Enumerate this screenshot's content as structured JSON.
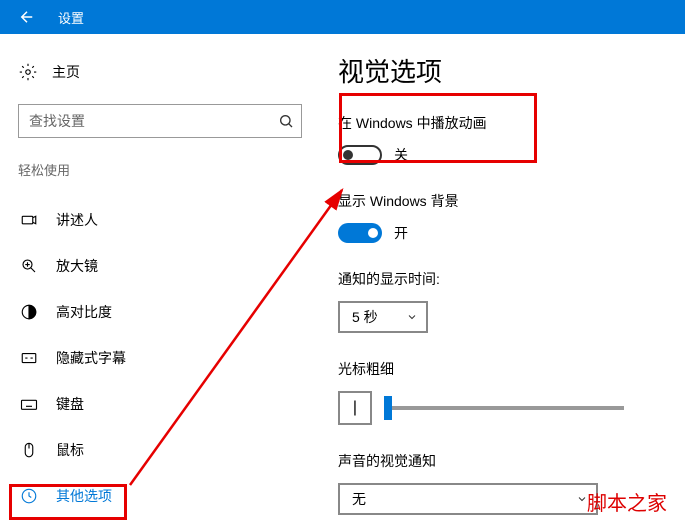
{
  "titlebar": {
    "title": "设置"
  },
  "sidebar": {
    "home": "主页",
    "search_placeholder": "查找设置",
    "category": "轻松使用",
    "items": [
      {
        "label": "讲述人"
      },
      {
        "label": "放大镜"
      },
      {
        "label": "高对比度"
      },
      {
        "label": "隐藏式字幕"
      },
      {
        "label": "键盘"
      },
      {
        "label": "鼠标"
      },
      {
        "label": "其他选项"
      }
    ]
  },
  "main": {
    "title": "视觉选项",
    "animations": {
      "label": "在 Windows 中播放动画",
      "state": "关"
    },
    "background": {
      "label": "显示 Windows 背景",
      "state": "开"
    },
    "notify_time": {
      "label": "通知的显示时间:",
      "value": "5 秒"
    },
    "cursor": {
      "label": "光标粗细",
      "preview": "|"
    },
    "sound_visual": {
      "label": "声音的视觉通知",
      "value": "无"
    }
  },
  "watermark": "脚本之家"
}
